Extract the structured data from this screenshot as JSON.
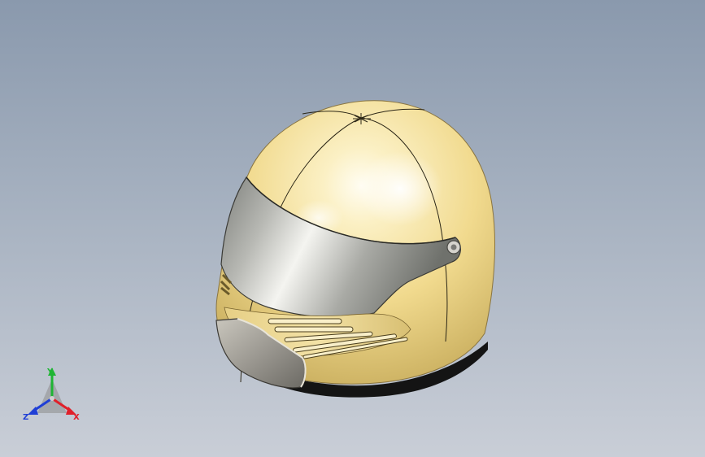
{
  "triad": {
    "x_label": "X",
    "y_label": "Y",
    "z_label": "Z",
    "x_color": "#e0202a",
    "y_color": "#1fb534",
    "z_color": "#1f3fd6"
  },
  "colors": {
    "background_top": "#8a99ad",
    "background_bottom": "#c9ced7",
    "helmet_shell": "#f0d98c",
    "visor": "#9ea09c",
    "chin_guard": "#a8a6a0",
    "base": "#141414"
  }
}
